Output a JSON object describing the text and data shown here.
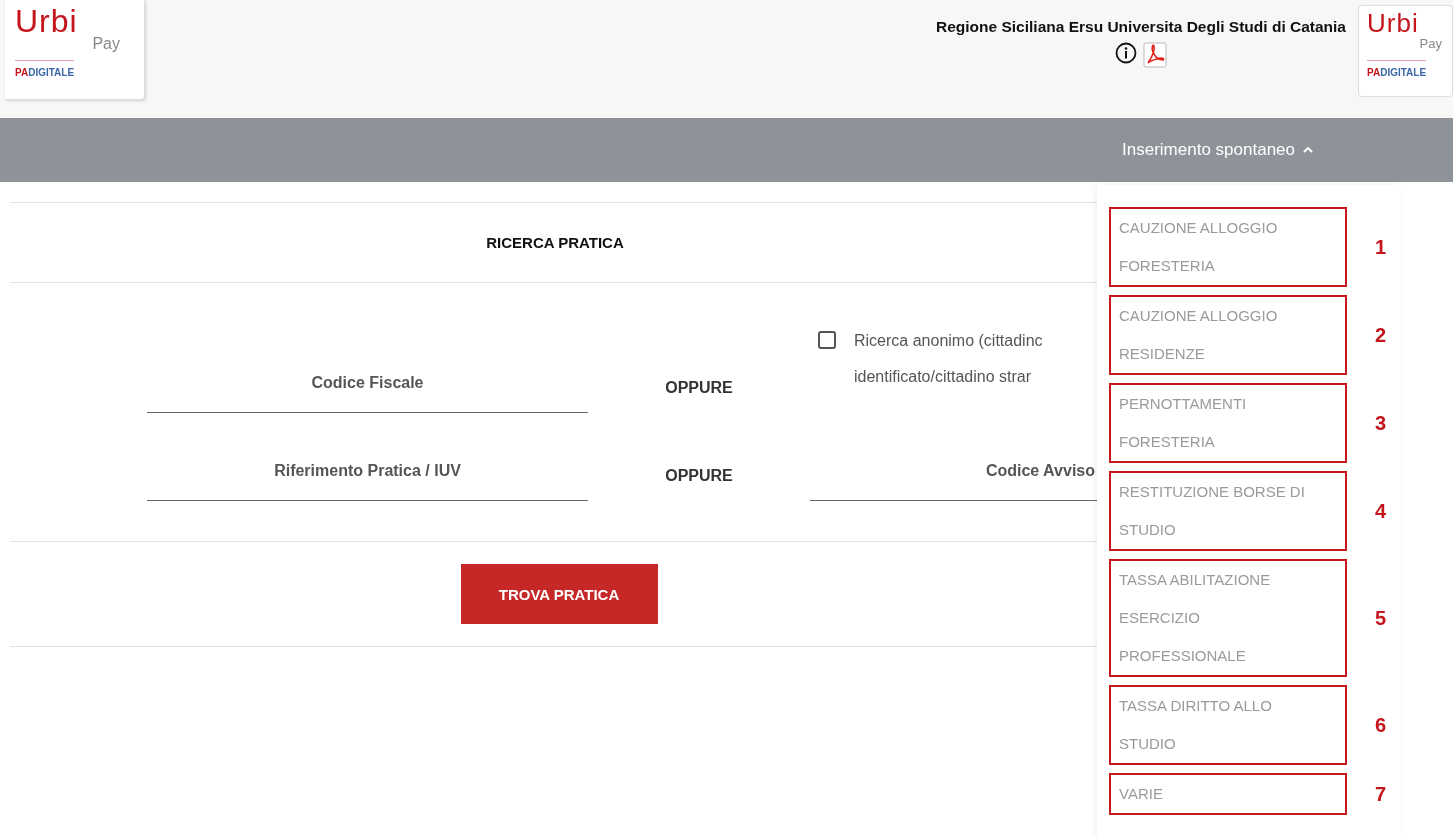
{
  "header": {
    "logo_left": {
      "word": "Urbi",
      "sub": "Pay",
      "brand_a": "PA",
      "brand_b": "DIGITALE"
    },
    "title": "Regione Siciliana Ersu Universita Degli Studi di Catania",
    "logo_right": {
      "word": "Urbi",
      "sub": "Pay",
      "brand_a": "PA",
      "brand_b": "DIGITALE"
    }
  },
  "nav": {
    "label": "Inserimento spontaneo",
    "expanded": true
  },
  "search": {
    "title": "RICERCA PRATICA",
    "rows": [
      {
        "field": {
          "placeholder": "Codice Fiscale"
        },
        "separator": "OPPURE",
        "alt": {
          "kind": "checkbox",
          "checked": false,
          "lines": [
            "Ricerca anonimo (cittadinc",
            "identificato/cittadino strar"
          ]
        }
      },
      {
        "field": {
          "placeholder": "Riferimento Pratica / IUV"
        },
        "separator": "OPPURE",
        "alt": {
          "kind": "field",
          "placeholder": "Codice Avviso"
        }
      }
    ],
    "button": "TROVA PRATICA"
  },
  "dropdown": {
    "items": [
      {
        "lines": [
          "CAUZIONE ALLOGGIO",
          "FORESTERIA"
        ],
        "marker": "1"
      },
      {
        "lines": [
          "CAUZIONE ALLOGGIO",
          "RESIDENZE"
        ],
        "marker": "2"
      },
      {
        "lines": [
          "PERNOTTAMENTI",
          "FORESTERIA"
        ],
        "marker": "3"
      },
      {
        "lines": [
          "RESTITUZIONE BORSE DI",
          "STUDIO"
        ],
        "marker": "4"
      },
      {
        "lines": [
          "TASSA ABILITAZIONE",
          "ESERCIZIO",
          "PROFESSIONALE"
        ],
        "marker": "5"
      },
      {
        "lines": [
          "TASSA DIRITTO ALLO",
          "STUDIO"
        ],
        "marker": "6"
      },
      {
        "lines": [
          "VARIE"
        ],
        "marker": "7"
      }
    ]
  }
}
